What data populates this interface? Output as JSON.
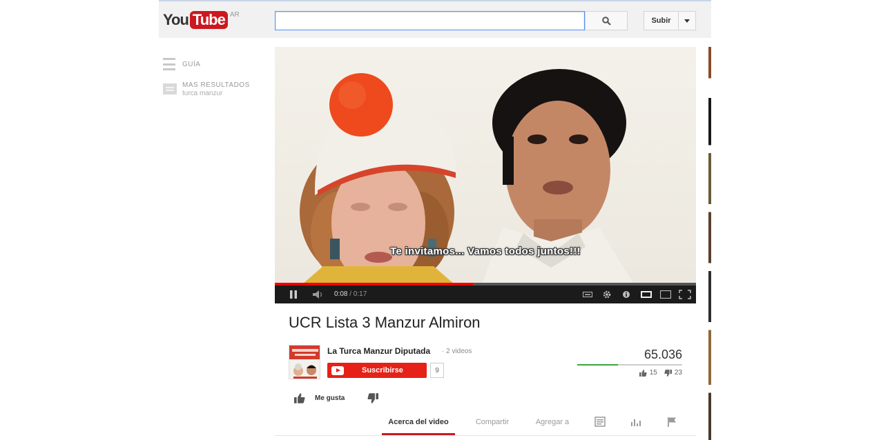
{
  "header": {
    "logo_you": "You",
    "logo_tube": "Tube",
    "logo_region": "AR",
    "search_value": "",
    "upload_label": "Subir"
  },
  "guide": {
    "guide_label": "GUÍA",
    "more_results_title": "MAS RESULTADOS",
    "more_results_query": "turca manzur"
  },
  "player": {
    "subtitle": "Te invitamos... Vamos todos juntos!!!",
    "current_time": "0:08",
    "duration": "/ 0:17",
    "progress_fraction": 0.47
  },
  "video": {
    "title": "UCR Lista 3 Manzur Almiron",
    "channel_name": "La Turca Manzur Diputada",
    "video_count": "· 2 videos",
    "subscribe_label": "Suscribirse",
    "subscriber_count": "9",
    "view_count": "65.036",
    "likes": "15",
    "dislikes": "23",
    "like_ratio": 0.39,
    "like_label": "Me gusta"
  },
  "tabs": {
    "about": "Acerca del video",
    "share": "Compartir",
    "add": "Agregar a"
  },
  "colors": {
    "brand_red": "#cc181e",
    "subscribe_red": "#e62117",
    "progress_red": "#ee0000",
    "sentiment_green": "#3ca33c"
  }
}
